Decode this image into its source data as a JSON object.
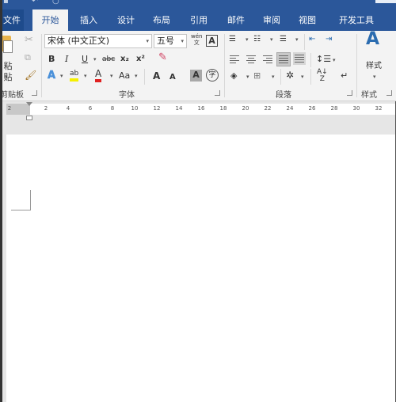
{
  "titlebar": {
    "quick_access": [
      "save-icon",
      "undo-icon",
      "redo-icon"
    ]
  },
  "tabs": [
    {
      "label": "文件",
      "active": false
    },
    {
      "label": "开始",
      "active": true
    },
    {
      "label": "插入",
      "active": false
    },
    {
      "label": "设计",
      "active": false
    },
    {
      "label": "布局",
      "active": false
    },
    {
      "label": "引用",
      "active": false
    },
    {
      "label": "邮件",
      "active": false
    },
    {
      "label": "审阅",
      "active": false
    },
    {
      "label": "视图",
      "active": false
    },
    {
      "label": "开发工具",
      "active": false
    }
  ],
  "ribbon": {
    "clipboard": {
      "paste_label": "粘贴",
      "group_label": "剪贴板",
      "icons": [
        "paste-icon",
        "cut-icon",
        "copy-icon",
        "format-painter-icon"
      ]
    },
    "font": {
      "font_name": "宋体 (中文正文)",
      "font_size": "五号",
      "phonetic_guide": "wén\n文",
      "bold": "B",
      "italic": "I",
      "underline": "U",
      "strikethrough": "abc",
      "subscript": "x₂",
      "superscript": "x²",
      "text_effects": "A",
      "highlight": "ab",
      "font_color": "A",
      "change_case": "Aa",
      "grow_font": "A",
      "shrink_font": "A",
      "char_shading": "A",
      "enclose_char": "字",
      "char_border": "A",
      "group_label": "字体",
      "highlight_color": "#f5f000",
      "font_color_value": "#e02020"
    },
    "paragraph": {
      "group_label": "段落",
      "icons": [
        "bullets-icon",
        "numbering-icon",
        "multilevel-list-icon",
        "decrease-indent-icon",
        "increase-indent-icon",
        "align-left-icon",
        "center-icon",
        "align-right-icon",
        "justify-icon",
        "distributed-icon",
        "line-spacing-icon",
        "shading-icon",
        "borders-icon",
        "asian-layout-icon",
        "sort-icon",
        "show-marks-icon"
      ]
    },
    "styles": {
      "label": "样式",
      "group_label": "样式"
    }
  },
  "ruler": {
    "ticks": [
      "2",
      "2",
      "4",
      "6",
      "8",
      "10",
      "12",
      "14",
      "16",
      "18",
      "20",
      "22",
      "24",
      "26",
      "28",
      "30",
      "32"
    ]
  },
  "colors": {
    "brand": "#2b579a",
    "ribbon_bg": "#f3f3f3"
  }
}
